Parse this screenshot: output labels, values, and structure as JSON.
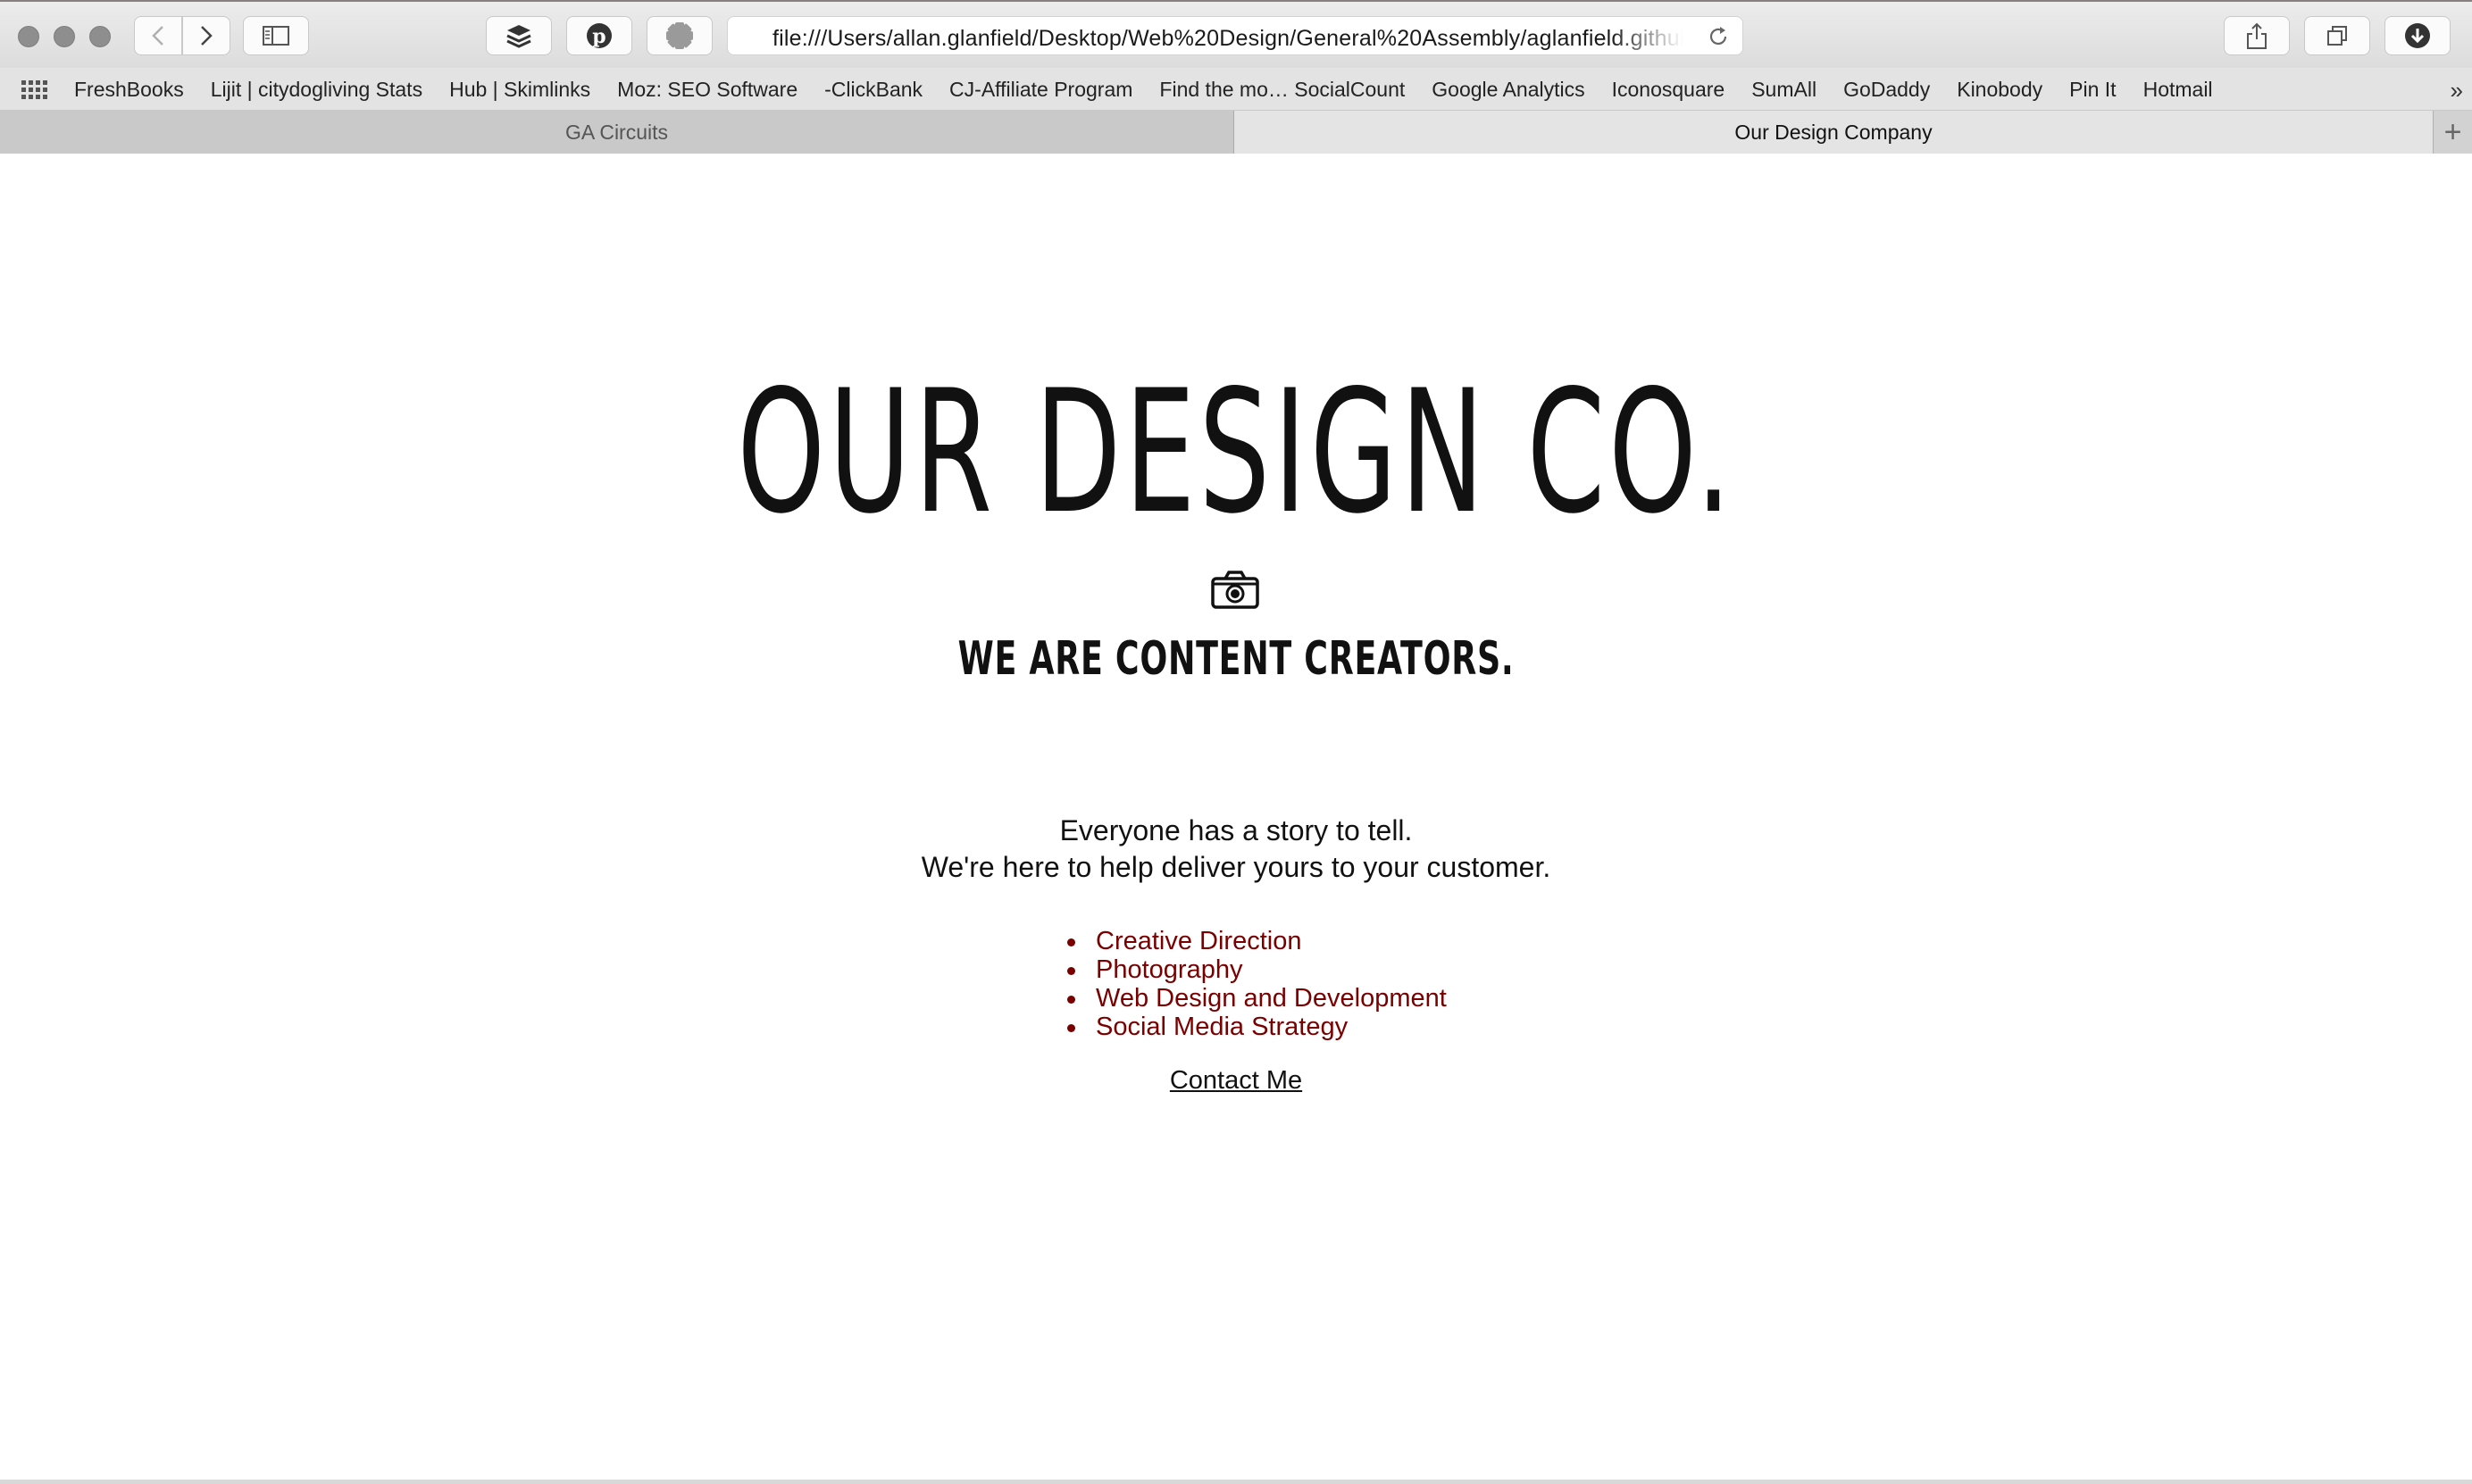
{
  "browser": {
    "url": "file:///Users/allan.glanfield/Desktop/Web%20Design/General%20Assembly/aglanfield.github.io/index.html",
    "bookmarks": [
      "FreshBooks",
      "Lijit | citydogliving Stats",
      "Hub | Skimlinks",
      "Moz: SEO Software",
      "-ClickBank",
      "CJ-Affiliate Program",
      "Find the mo… SocialCount",
      "Google Analytics",
      "Iconosquare",
      "SumAll",
      "GoDaddy",
      "Kinobody",
      "Pin It",
      "Hotmail"
    ],
    "bookmarks_overflow": "»",
    "tabs": [
      {
        "label": "GA Circuits",
        "active": false
      },
      {
        "label": "Our Design Company",
        "active": true
      }
    ],
    "new_tab_label": "+"
  },
  "page": {
    "title": "OUR DESIGN CO.",
    "icon": "camera-icon",
    "tagline": "WE ARE CONTENT CREATORS.",
    "story_line_1": "Everyone has a story to tell.",
    "story_line_2": "We're here to help deliver yours to your customer.",
    "services": [
      "Creative Direction",
      "Photography",
      "Web Design and Development",
      "Social Media Strategy"
    ],
    "contact_label": "Contact Me"
  },
  "colors": {
    "service_link": "#7a0000",
    "text": "#111111",
    "chrome": "#e3e3e3"
  }
}
